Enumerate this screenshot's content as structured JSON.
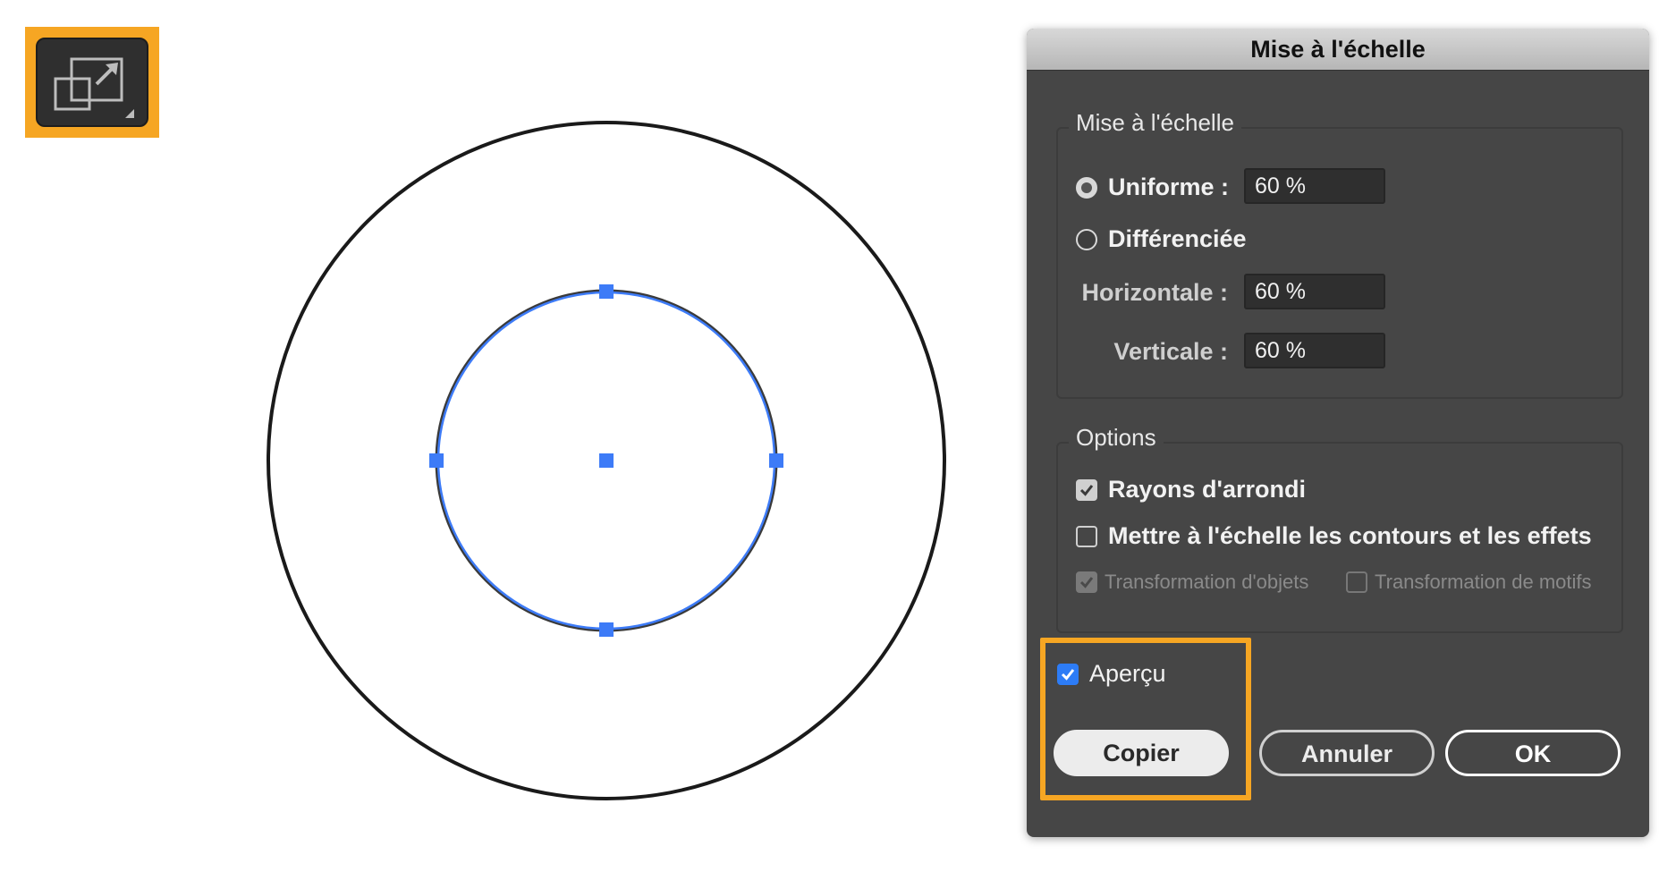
{
  "dialog": {
    "title": "Mise à l'échelle",
    "scale_group": {
      "title": "Mise à l'échelle",
      "uniform_label": "Uniforme :",
      "uniform_value": "60 %",
      "non_uniform_label": "Différenciée",
      "horizontal_label": "Horizontale :",
      "horizontal_value": "60 %",
      "vertical_label": "Verticale :",
      "vertical_value": "60 %",
      "selected_mode": "Uniforme"
    },
    "options_group": {
      "title": "Options",
      "corner_radii_label": "Rayons d'arrondi",
      "corner_radii_checked": true,
      "scale_strokes_label": "Mettre à l'échelle les contours et les effets",
      "scale_strokes_checked": false,
      "transform_objects_label": "Transformation d'objets",
      "transform_objects_checked": true,
      "transform_patterns_label": "Transformation de motifs",
      "transform_patterns_checked": false
    },
    "preview_label": "Aperçu",
    "preview_checked": true,
    "buttons": {
      "copy": "Copier",
      "cancel": "Annuler",
      "ok": "OK"
    }
  },
  "toolbar": {
    "scale_tool_icon": "scale-tool-icon"
  },
  "colors": {
    "highlight": "#f6a623",
    "selection": "#3d7bf7",
    "dialog_bg": "#464646"
  }
}
